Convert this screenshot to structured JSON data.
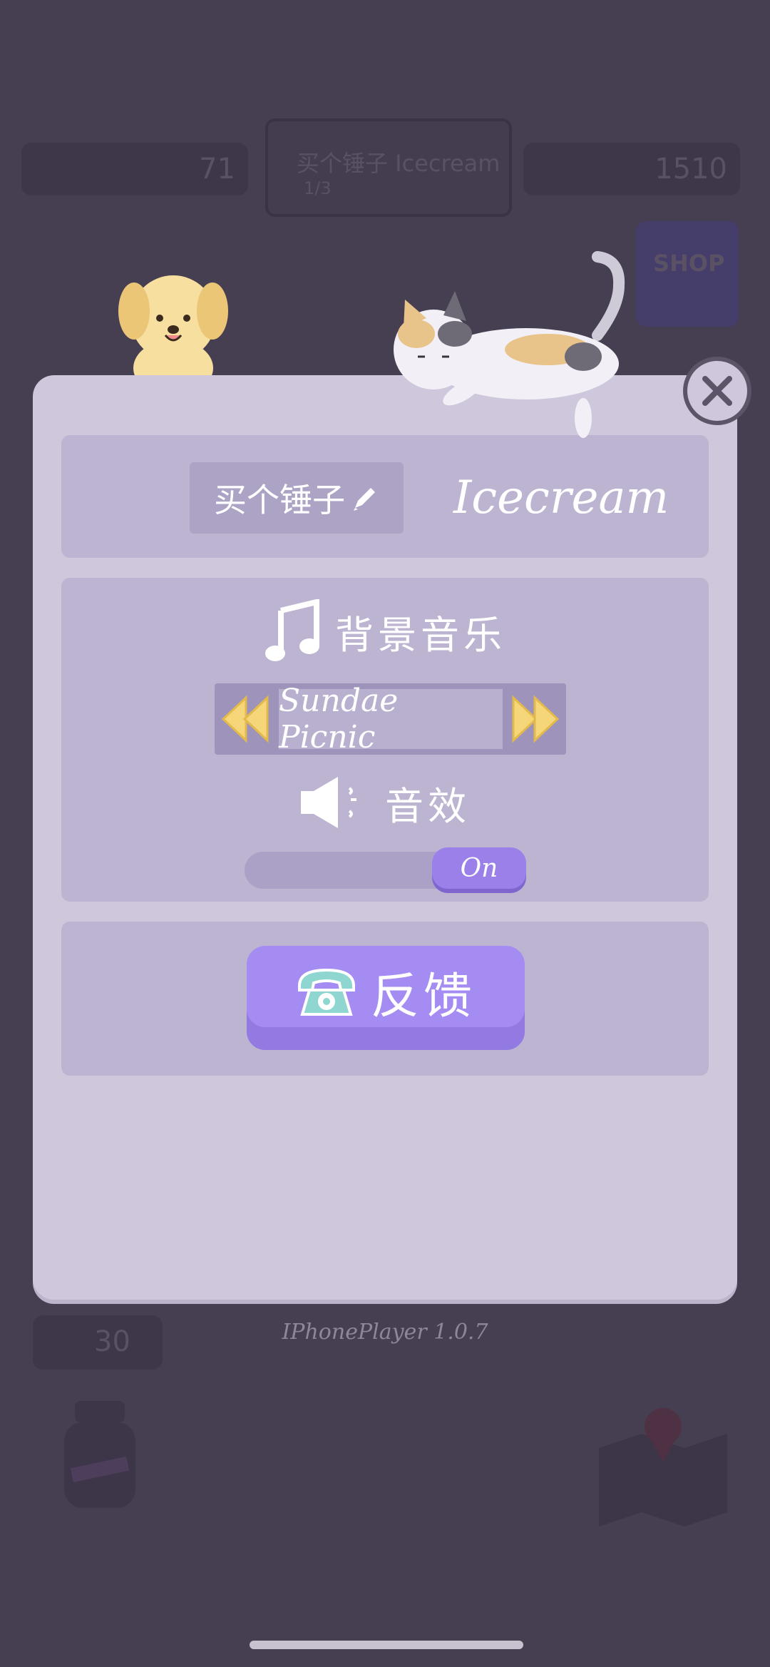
{
  "background": {
    "leaf_count": "71",
    "quest_title": "买个锤子 Icecream",
    "quest_progress": "1/3",
    "coin_count": "1510",
    "shop_label": "SHOP",
    "heart_count": "30"
  },
  "settings": {
    "nickname": "买个锤子",
    "player_name": "Icecream",
    "music_label": "背景音乐",
    "track_name": "Sundae Picnic",
    "sfx_label": "音效",
    "sfx_state": "On",
    "feedback_label": "反馈"
  },
  "version": "IPhonePlayer 1.0.7",
  "colors": {
    "modal": "#cfc8dc",
    "section": "#bdb4d2",
    "accent": "#a58cf2",
    "arrow": "#f5d77a"
  },
  "icons": [
    "pencil-icon",
    "music-note-icon",
    "speaker-icon",
    "phone-icon",
    "close-icon",
    "rewind-icon",
    "fast-forward-icon"
  ]
}
